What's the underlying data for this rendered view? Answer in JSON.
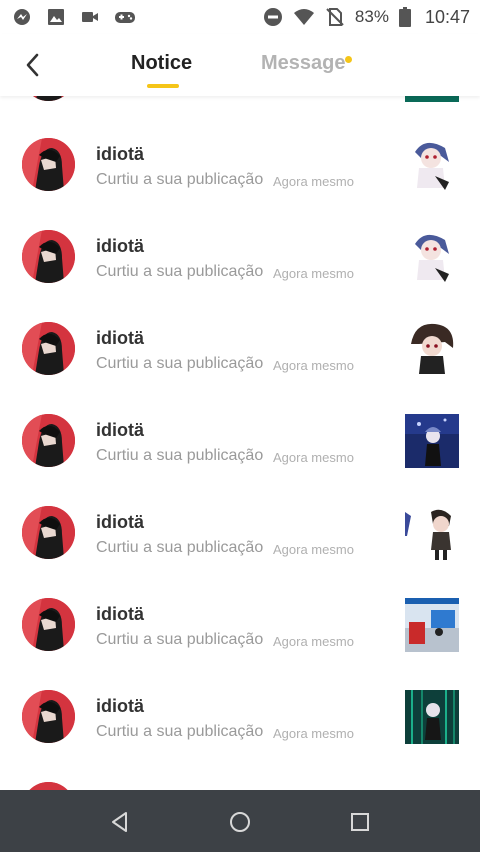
{
  "status_bar": {
    "left_icons": [
      "messenger-icon",
      "gallery-icon",
      "video-icon",
      "gamepad-icon"
    ],
    "right_icons": [
      "do-not-disturb-icon",
      "wifi-icon",
      "no-sim-icon",
      "battery-icon"
    ],
    "battery": "83%",
    "time": "10:47"
  },
  "header": {
    "back_icon": "chevron-left-icon",
    "tabs": [
      {
        "label": "Notice",
        "active": true
      },
      {
        "label": "Message",
        "active": false,
        "has_badge": true
      }
    ],
    "accent_color": "#f5c518"
  },
  "notifications": [
    {
      "username": "idiotä",
      "action": "Curtiu a sua publicação",
      "time": "Agora mesmo",
      "thumb": "chibi-white-hair"
    },
    {
      "username": "idiotä",
      "action": "Curtiu a sua publicação",
      "time": "Agora mesmo",
      "thumb": "chibi-white-hair"
    },
    {
      "username": "idiotä",
      "action": "Curtiu a sua publicação",
      "time": "Agora mesmo",
      "thumb": "chibi-brown-hair"
    },
    {
      "username": "idiotä",
      "action": "Curtiu a sua publicação",
      "time": "Agora mesmo",
      "thumb": "chibi-blue-scene"
    },
    {
      "username": "idiotä",
      "action": "Curtiu a sua publicação",
      "time": "Agora mesmo",
      "thumb": "chibi-dark-hair"
    },
    {
      "username": "idiotä",
      "action": "Curtiu a sua publicação",
      "time": "Agora mesmo",
      "thumb": "room-scene"
    },
    {
      "username": "idiotä",
      "action": "Curtiu a sua publicação",
      "time": "Agora mesmo",
      "thumb": "green-scene"
    }
  ],
  "nav_bar": {
    "buttons": [
      "back-triangle-icon",
      "home-circle-icon",
      "recents-square-icon"
    ]
  }
}
